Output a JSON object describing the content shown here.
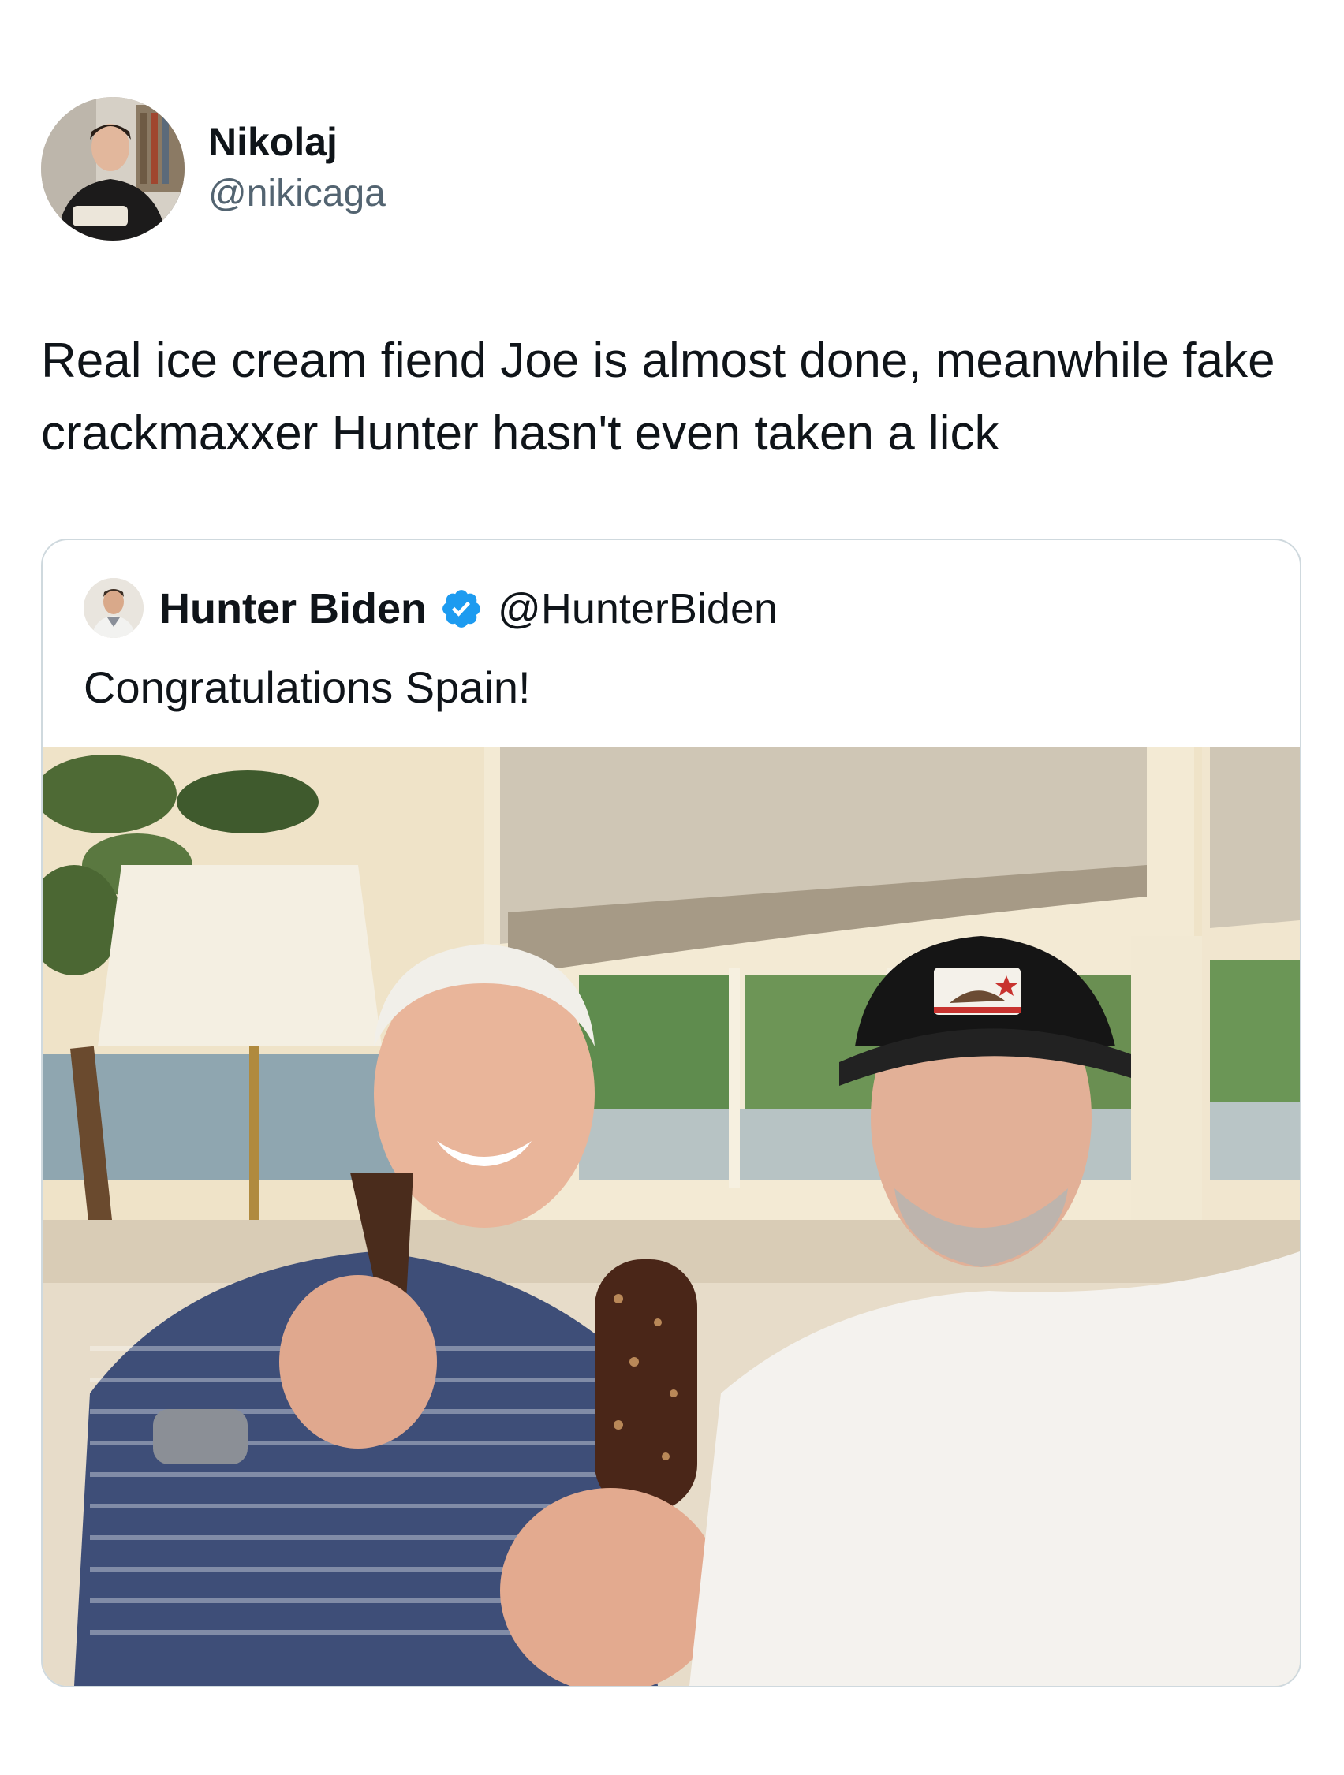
{
  "tweet": {
    "author": {
      "name": "Nikolaj",
      "handle": "@nikicaga",
      "avatar_icon": "profile-photo"
    },
    "text": "Real ice cream fiend Joe is almost done, meanwhile fake crackmaxxer Hunter hasn't even taken a lick",
    "quoted": {
      "author": {
        "name": "Hunter Biden",
        "handle": "@HunterBiden",
        "verified": true,
        "verified_color": "#1d9bf0",
        "avatar_icon": "profile-photo"
      },
      "text": "Congratulations Spain!",
      "media": {
        "type": "photo"
      }
    }
  }
}
